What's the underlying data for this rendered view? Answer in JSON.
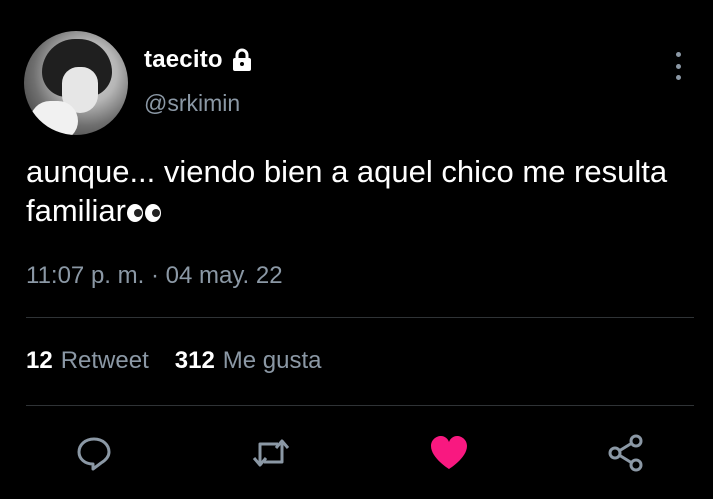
{
  "tweet": {
    "author_name": "taecito",
    "author_handle": "@srkimin",
    "text_before_emoji": "aunque... viendo bien a aquel chico me resulta familiar",
    "emoji": "eyes-icon",
    "timestamp": "11:07 p. m. · 04 may. 22"
  },
  "stats": {
    "retweets_count": "12",
    "retweets_label": "Retweet",
    "likes_count": "312",
    "likes_label": "Me gusta"
  },
  "actions": [
    {
      "name": "reply",
      "icon": "reply-icon"
    },
    {
      "name": "retweet",
      "icon": "retweet-icon"
    },
    {
      "name": "like",
      "icon": "heart-icon",
      "color": "#f91880"
    },
    {
      "name": "share",
      "icon": "share-icon"
    }
  ],
  "colors": {
    "background": "#000000",
    "primary_text": "#ffffff",
    "secondary_text": "#8b98a5",
    "like": "#f91880",
    "divider": "#2f3336"
  }
}
